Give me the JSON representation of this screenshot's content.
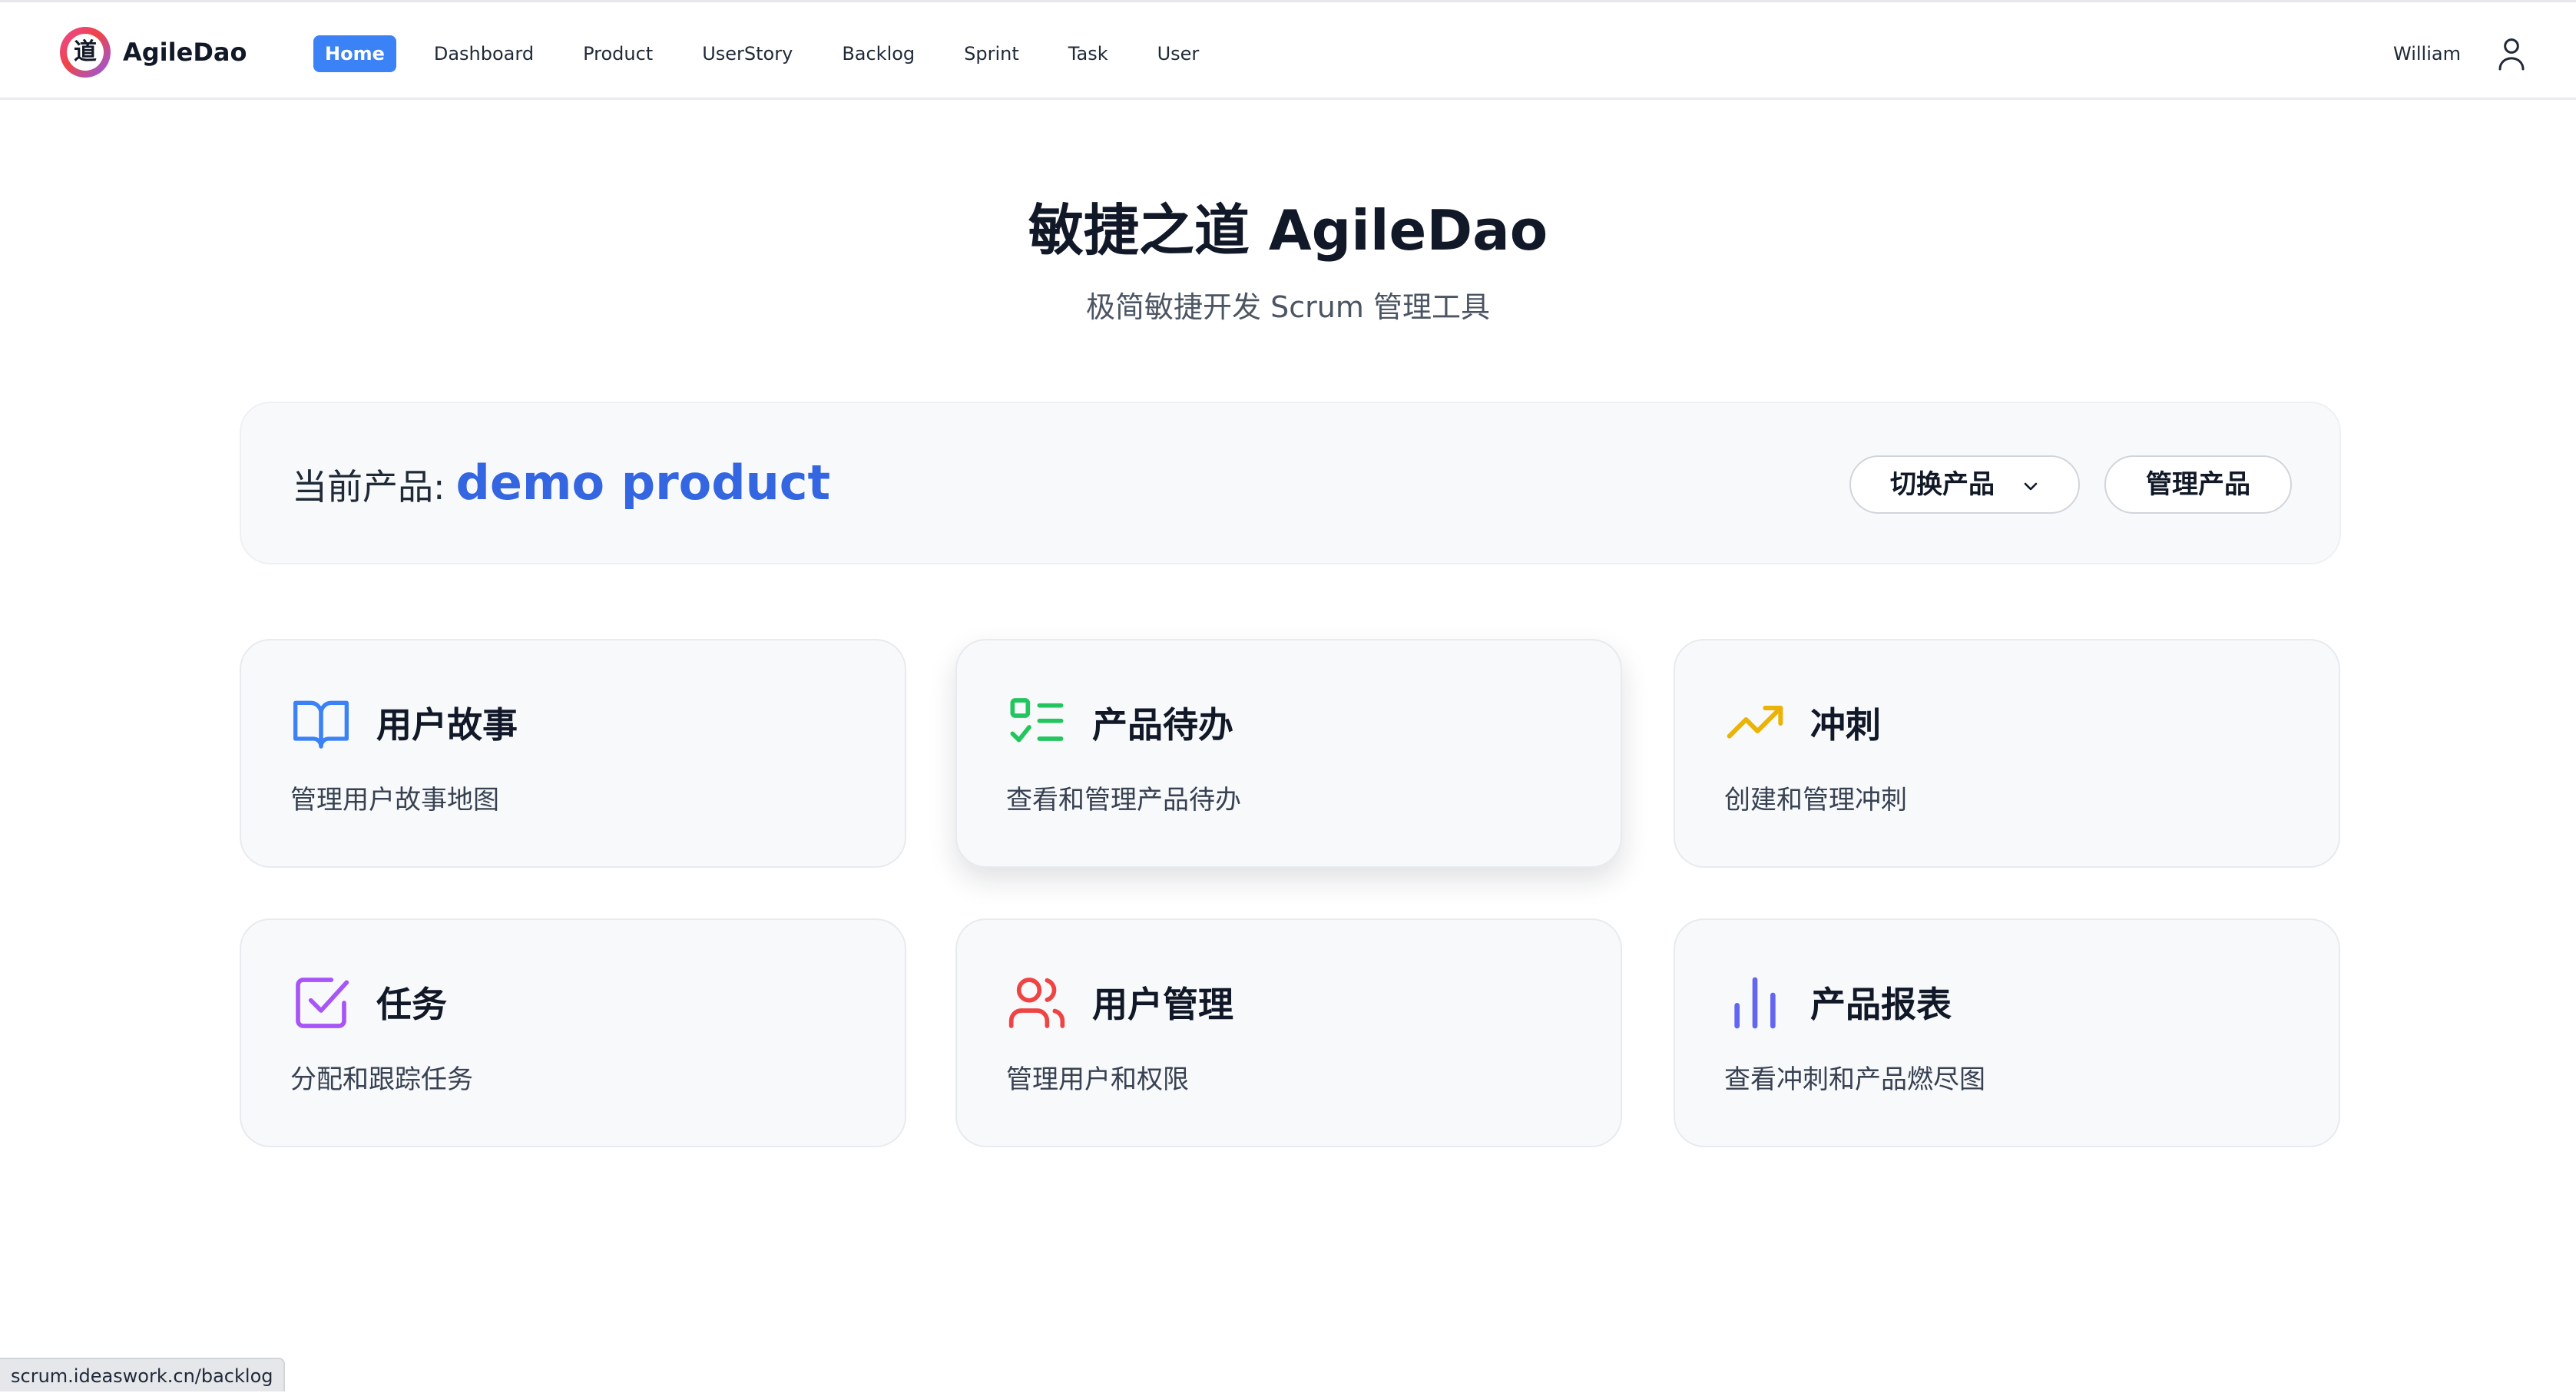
{
  "app": {
    "logo_glyph": "道",
    "name": "AgileDao"
  },
  "nav": {
    "items": [
      {
        "label": "Home",
        "active": true
      },
      {
        "label": "Dashboard",
        "active": false
      },
      {
        "label": "Product",
        "active": false
      },
      {
        "label": "UserStory",
        "active": false
      },
      {
        "label": "Backlog",
        "active": false
      },
      {
        "label": "Sprint",
        "active": false
      },
      {
        "label": "Task",
        "active": false
      },
      {
        "label": "User",
        "active": false
      }
    ],
    "active_color": "#3b82f6"
  },
  "user": {
    "name": "William",
    "icon": "user-icon"
  },
  "hero": {
    "title": "敏捷之道 AgileDao",
    "subtitle": "极简敏捷开发 Scrum 管理工具"
  },
  "current_product": {
    "label": "当前产品:",
    "name": "demo product",
    "name_color": "#3366e0",
    "switch_label": "切换产品",
    "switch_icon": "chevron-down-icon",
    "manage_label": "管理产品"
  },
  "features": [
    {
      "title": "用户故事",
      "description": "管理用户故事地图",
      "icon": "book-open-icon",
      "color": "#3b82f6"
    },
    {
      "title": "产品待办",
      "description": "查看和管理产品待办",
      "icon": "list-checks-icon",
      "color": "#22c55e"
    },
    {
      "title": "冲刺",
      "description": "创建和管理冲刺",
      "icon": "trending-up-icon",
      "color": "#eab308"
    },
    {
      "title": "任务",
      "description": "分配和跟踪任务",
      "icon": "check-square-icon",
      "color": "#a855f7"
    },
    {
      "title": "用户管理",
      "description": "管理用户和权限",
      "icon": "users-icon",
      "color": "#ef4444"
    },
    {
      "title": "产品报表",
      "description": "查看冲刺和产品燃尽图",
      "icon": "bar-chart-icon",
      "color": "#6366f1"
    }
  ],
  "status_bar": {
    "url": "scrum.ideaswork.cn/backlog"
  }
}
